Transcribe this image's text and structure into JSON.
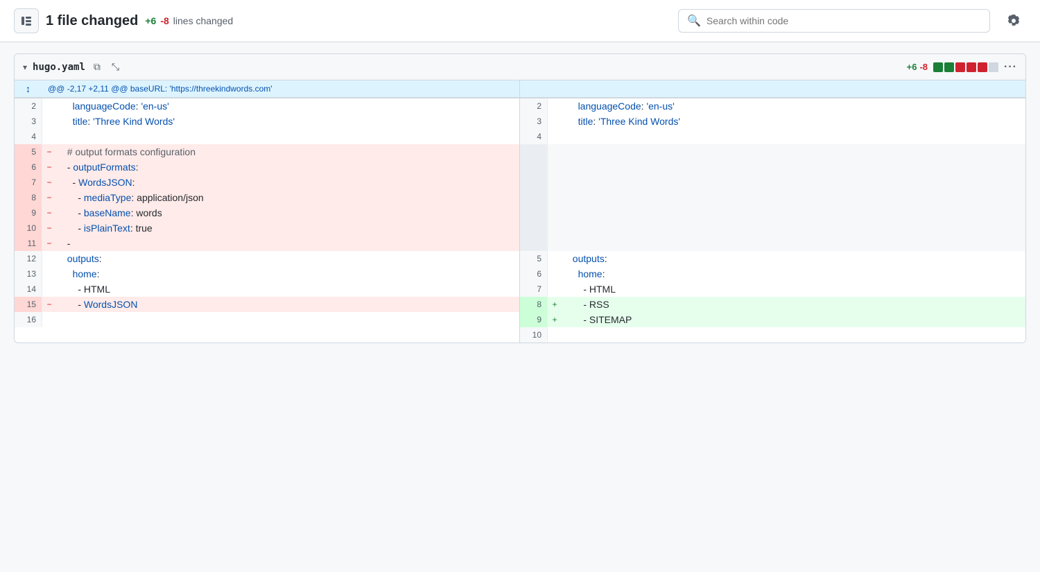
{
  "header": {
    "title": "1 file changed",
    "stats_plus": "+6",
    "stats_minus": "-8",
    "stats_label": "lines changed",
    "search_placeholder": "Search within code",
    "settings_icon": "⚙"
  },
  "file": {
    "name": "hugo.yaml",
    "diff_plus": "+6",
    "diff_minus": "-8",
    "more_icon": "···",
    "hunk": "@@ -2,17 +2,11 @@ baseURL: 'https://threekindwords.com'",
    "diff_blocks": [
      "green",
      "green",
      "red",
      "red",
      "red",
      "gray"
    ],
    "left_lines": [
      {
        "num": "2",
        "marker": "",
        "code": "    languageCode: 'en-us'",
        "type": "normal"
      },
      {
        "num": "3",
        "marker": "",
        "code": "    title: 'Three Kind Words'",
        "type": "normal"
      },
      {
        "num": "4",
        "marker": "",
        "code": "",
        "type": "normal"
      },
      {
        "num": "5",
        "marker": "-",
        "code": "  - # output formats configuration",
        "type": "deleted"
      },
      {
        "num": "6",
        "marker": "-",
        "code": "  - outputFormats:",
        "type": "deleted"
      },
      {
        "num": "7",
        "marker": "-",
        "code": "    - WordsJSON:",
        "type": "deleted"
      },
      {
        "num": "8",
        "marker": "-",
        "code": "      - mediaType: application/json",
        "type": "deleted"
      },
      {
        "num": "9",
        "marker": "-",
        "code": "      - baseName: words",
        "type": "deleted"
      },
      {
        "num": "10",
        "marker": "-",
        "code": "      - isPlainText: true",
        "type": "deleted"
      },
      {
        "num": "11",
        "marker": "-",
        "code": "  -",
        "type": "deleted"
      },
      {
        "num": "12",
        "marker": "",
        "code": "  outputs:",
        "type": "normal"
      },
      {
        "num": "13",
        "marker": "",
        "code": "    home:",
        "type": "normal"
      },
      {
        "num": "14",
        "marker": "",
        "code": "      - HTML",
        "type": "normal"
      },
      {
        "num": "15",
        "marker": "-",
        "code": "      - WordsJSON",
        "type": "deleted"
      },
      {
        "num": "16",
        "marker": "",
        "code": "",
        "type": "normal"
      }
    ],
    "right_lines": [
      {
        "num": "2",
        "marker": "",
        "code": "    languageCode: 'en-us'",
        "type": "normal"
      },
      {
        "num": "3",
        "marker": "",
        "code": "    title: 'Three Kind Words'",
        "type": "normal"
      },
      {
        "num": "4",
        "marker": "",
        "code": "",
        "type": "normal"
      },
      {
        "num": "",
        "marker": "",
        "code": "",
        "type": "empty"
      },
      {
        "num": "",
        "marker": "",
        "code": "",
        "type": "empty"
      },
      {
        "num": "",
        "marker": "",
        "code": "",
        "type": "empty"
      },
      {
        "num": "",
        "marker": "",
        "code": "",
        "type": "empty"
      },
      {
        "num": "",
        "marker": "",
        "code": "",
        "type": "empty"
      },
      {
        "num": "",
        "marker": "",
        "code": "",
        "type": "empty"
      },
      {
        "num": "",
        "marker": "",
        "code": "",
        "type": "empty"
      },
      {
        "num": "5",
        "marker": "",
        "code": "  outputs:",
        "type": "normal"
      },
      {
        "num": "6",
        "marker": "",
        "code": "    home:",
        "type": "normal"
      },
      {
        "num": "7",
        "marker": "",
        "code": "      - HTML",
        "type": "normal"
      },
      {
        "num": "8",
        "marker": "+",
        "code": "      - RSS",
        "type": "added"
      },
      {
        "num": "9",
        "marker": "+",
        "code": "      - SITEMAP",
        "type": "added"
      },
      {
        "num": "10",
        "marker": "",
        "code": "",
        "type": "normal"
      }
    ]
  }
}
